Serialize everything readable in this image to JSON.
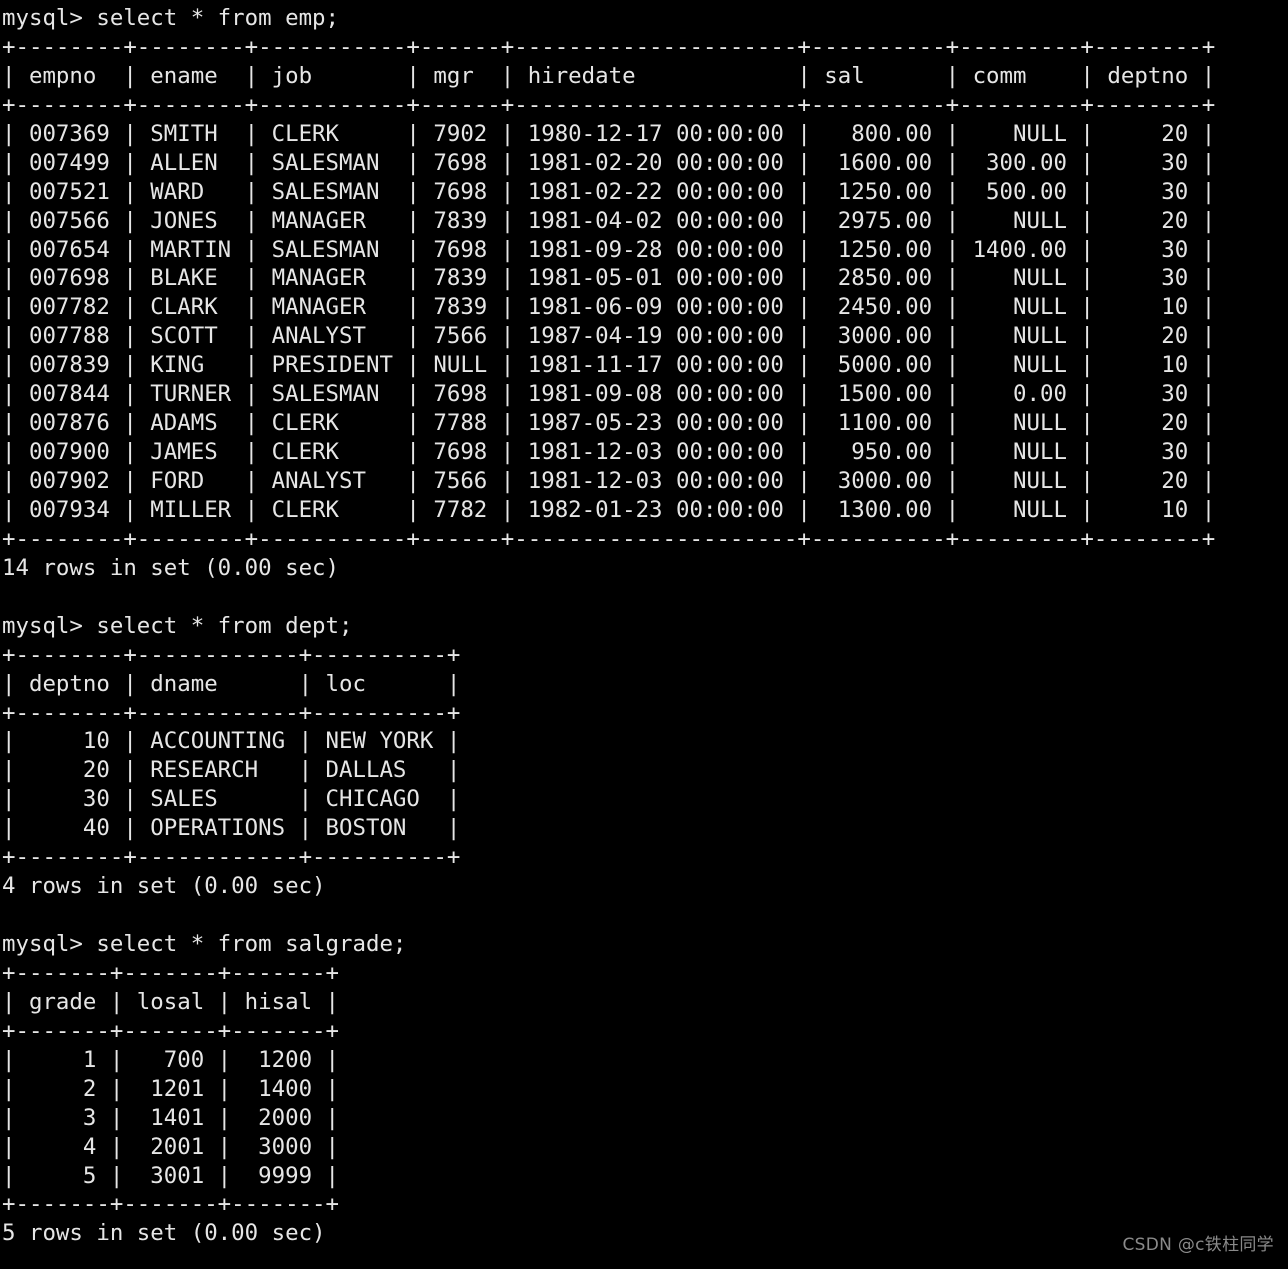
{
  "terminal": {
    "prompt": "mysql> ",
    "background_color": "#000000",
    "foreground_color": "#e6e6e6",
    "watermark": "CSDN @c铁柱同学",
    "watermark_color": "#8a8a8a"
  },
  "queries": [
    {
      "name": "emp-query",
      "command": "select * from emp;",
      "table": {
        "columns": [
          "empno",
          "ename",
          "job",
          "mgr",
          "hiredate",
          "sal",
          "comm",
          "deptno"
        ],
        "widths": [
          8,
          8,
          11,
          6,
          21,
          10,
          9,
          8
        ],
        "aligns": [
          "right",
          "left",
          "left",
          "right",
          "left",
          "right",
          "right",
          "right"
        ],
        "rows": [
          [
            "007369",
            "SMITH",
            "CLERK",
            "7902",
            "1980-12-17 00:00:00",
            "800.00",
            "NULL",
            "20"
          ],
          [
            "007499",
            "ALLEN",
            "SALESMAN",
            "7698",
            "1981-02-20 00:00:00",
            "1600.00",
            "300.00",
            "30"
          ],
          [
            "007521",
            "WARD",
            "SALESMAN",
            "7698",
            "1981-02-22 00:00:00",
            "1250.00",
            "500.00",
            "30"
          ],
          [
            "007566",
            "JONES",
            "MANAGER",
            "7839",
            "1981-04-02 00:00:00",
            "2975.00",
            "NULL",
            "20"
          ],
          [
            "007654",
            "MARTIN",
            "SALESMAN",
            "7698",
            "1981-09-28 00:00:00",
            "1250.00",
            "1400.00",
            "30"
          ],
          [
            "007698",
            "BLAKE",
            "MANAGER",
            "7839",
            "1981-05-01 00:00:00",
            "2850.00",
            "NULL",
            "30"
          ],
          [
            "007782",
            "CLARK",
            "MANAGER",
            "7839",
            "1981-06-09 00:00:00",
            "2450.00",
            "NULL",
            "10"
          ],
          [
            "007788",
            "SCOTT",
            "ANALYST",
            "7566",
            "1987-04-19 00:00:00",
            "3000.00",
            "NULL",
            "20"
          ],
          [
            "007839",
            "KING",
            "PRESIDENT",
            "NULL",
            "1981-11-17 00:00:00",
            "5000.00",
            "NULL",
            "10"
          ],
          [
            "007844",
            "TURNER",
            "SALESMAN",
            "7698",
            "1981-09-08 00:00:00",
            "1500.00",
            "0.00",
            "30"
          ],
          [
            "007876",
            "ADAMS",
            "CLERK",
            "7788",
            "1987-05-23 00:00:00",
            "1100.00",
            "NULL",
            "20"
          ],
          [
            "007900",
            "JAMES",
            "CLERK",
            "7698",
            "1981-12-03 00:00:00",
            "950.00",
            "NULL",
            "30"
          ],
          [
            "007902",
            "FORD",
            "ANALYST",
            "7566",
            "1981-12-03 00:00:00",
            "3000.00",
            "NULL",
            "20"
          ],
          [
            "007934",
            "MILLER",
            "CLERK",
            "7782",
            "1982-01-23 00:00:00",
            "1300.00",
            "NULL",
            "10"
          ]
        ]
      },
      "status": "14 rows in set (0.00 sec)"
    },
    {
      "name": "dept-query",
      "command": "select * from dept;",
      "table": {
        "columns": [
          "deptno",
          "dname",
          "loc"
        ],
        "widths": [
          8,
          12,
          10
        ],
        "aligns": [
          "right",
          "left",
          "left"
        ],
        "rows": [
          [
            "10",
            "ACCOUNTING",
            "NEW YORK"
          ],
          [
            "20",
            "RESEARCH",
            "DALLAS"
          ],
          [
            "30",
            "SALES",
            "CHICAGO"
          ],
          [
            "40",
            "OPERATIONS",
            "BOSTON"
          ]
        ]
      },
      "status": "4 rows in set (0.00 sec)"
    },
    {
      "name": "salgrade-query",
      "command": "select * from salgrade;",
      "table": {
        "columns": [
          "grade",
          "losal",
          "hisal"
        ],
        "widths": [
          7,
          7,
          7
        ],
        "aligns": [
          "right",
          "right",
          "right"
        ],
        "rows": [
          [
            "1",
            "700",
            "1200"
          ],
          [
            "2",
            "1201",
            "1400"
          ],
          [
            "3",
            "1401",
            "2000"
          ],
          [
            "4",
            "2001",
            "3000"
          ],
          [
            "5",
            "3001",
            "9999"
          ]
        ]
      },
      "status": "5 rows in set (0.00 sec)"
    }
  ]
}
